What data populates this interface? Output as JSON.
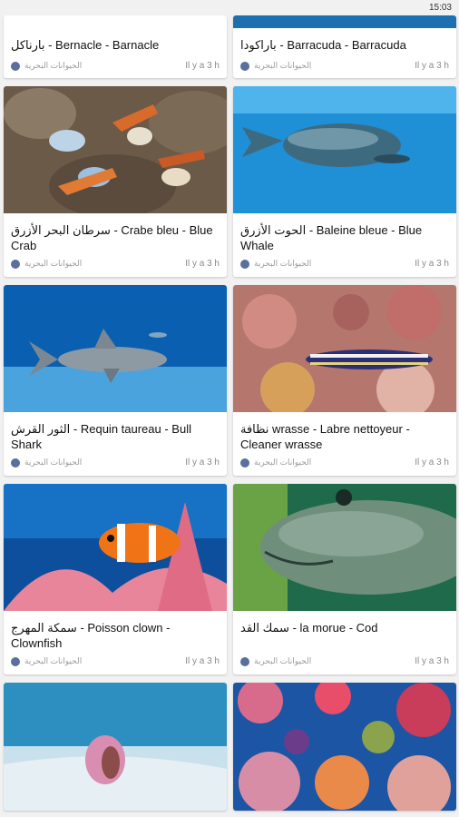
{
  "status": {
    "time": "15:03"
  },
  "cards": [
    {
      "title": "بارناكل - Bernacle -  Barnacle",
      "category": "الحيوانات البحرية",
      "time": "Il y a 3 h"
    },
    {
      "title": "باراكودا - Barracuda - Barracuda",
      "category": "الحيوانات البحرية",
      "time": "Il y a 3 h"
    },
    {
      "title": "سرطان البحر الأزرق - Crabe bleu - Blue Crab",
      "category": "الحيوانات البحرية",
      "time": "Il y a 3 h"
    },
    {
      "title": "الحوت الأزرق - Baleine bleue -  Blue Whale",
      "category": "الحيوانات البحرية",
      "time": "Il y a 3 h"
    },
    {
      "title": "الثور القرش - Requin taureau - Bull Shark",
      "category": "الحيوانات البحرية",
      "time": "Il y a 3 h"
    },
    {
      "title": "نظافة wrasse - Labre nettoyeur - Cleaner wrasse",
      "category": "الحيوانات البحرية",
      "time": "Il y a 3 h"
    },
    {
      "title": "سمكة المهرج - Poisson clown - Clownfish",
      "category": "الحيوانات البحرية",
      "time": "Il y a 3 h"
    },
    {
      "title": "سمك القد - la morue - Cod",
      "category": "الحيوانات البحرية",
      "time": "Il y a 3 h"
    }
  ]
}
